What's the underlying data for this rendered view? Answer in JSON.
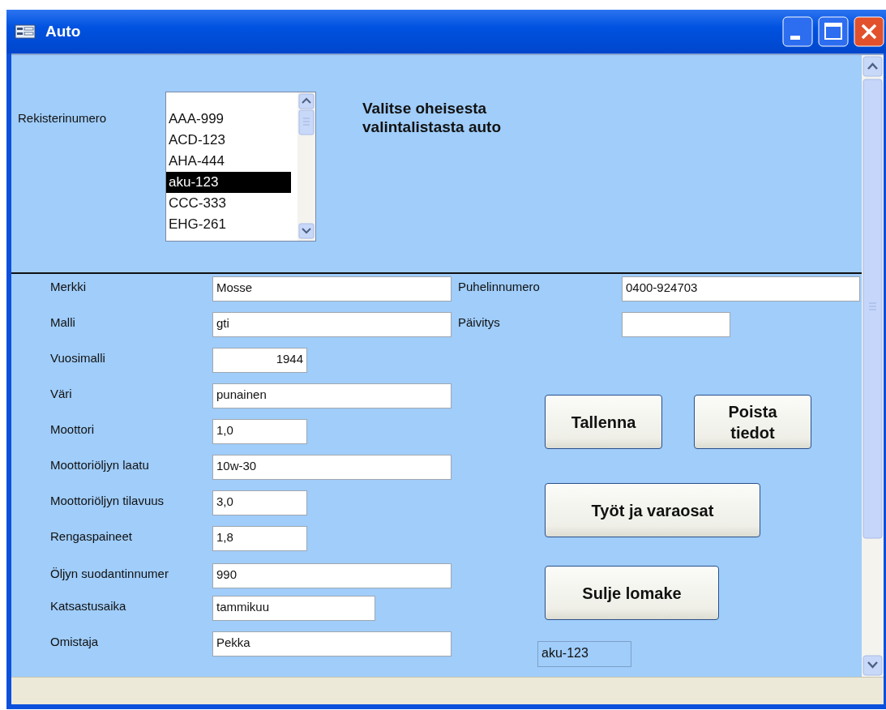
{
  "window": {
    "title": "Auto"
  },
  "header": {
    "list_label": "Rekisterinumero",
    "registrations": [
      {
        "text": "AAA-999",
        "selected": false
      },
      {
        "text": "ACD-123",
        "selected": false
      },
      {
        "text": "AHA-444",
        "selected": false
      },
      {
        "text": "aku-123",
        "selected": true
      },
      {
        "text": "CCC-333",
        "selected": false
      },
      {
        "text": "EHG-261",
        "selected": false
      }
    ],
    "instruction": "Valitse oheisesta valintalistasta auto"
  },
  "fields": [
    {
      "label": "Merkki",
      "value": "Mosse"
    },
    {
      "label": "Malli",
      "value": "gti"
    },
    {
      "label": "Vuosimalli",
      "value": "1944"
    },
    {
      "label": "Väri",
      "value": "punainen"
    },
    {
      "label": "Moottori",
      "value": "1,0"
    },
    {
      "label": "Moottoriöljyn laatu",
      "value": "10w-30"
    },
    {
      "label": "Moottoriöljyn tilavuus",
      "value": "3,0"
    },
    {
      "label": "Rengaspaineet",
      "value": "1,8"
    },
    {
      "label": "Öljyn suodantinnumer",
      "value": "990"
    },
    {
      "label": "Katsastusaika",
      "value": "tammikuu"
    },
    {
      "label": "Omistaja",
      "value": "Pekka"
    }
  ],
  "right_fields": [
    {
      "label": "Puhelinnumero",
      "value": "0400-924703"
    },
    {
      "label": "Päivitys"
    }
  ],
  "button_rows": [
    [
      "Tallenna",
      "Poista tiedot"
    ],
    [
      "Työt ja varaosat"
    ],
    [
      "Sulje lomake"
    ]
  ],
  "current_record": "aku-123"
}
